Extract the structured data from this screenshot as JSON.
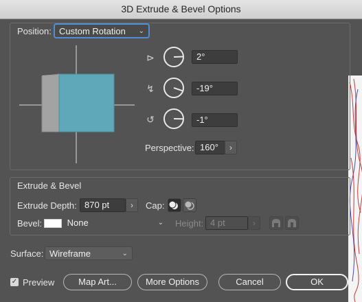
{
  "title": "3D Extrude & Bevel Options",
  "position": {
    "label": "Position:",
    "value": "Custom Rotation",
    "rotations": [
      {
        "axis": "x",
        "value": "2°",
        "angle": 2
      },
      {
        "axis": "y",
        "value": "-19°",
        "angle": -19
      },
      {
        "axis": "z",
        "value": "-1°",
        "angle": -1
      }
    ],
    "perspective_label": "Perspective:",
    "perspective_value": "160°"
  },
  "extrude_bevel": {
    "heading": "Extrude & Bevel",
    "depth_label": "Extrude Depth:",
    "depth_value": "870 pt",
    "cap_label": "Cap:",
    "bevel_label": "Bevel:",
    "bevel_value": "None",
    "height_label": "Height:",
    "height_value": "4 pt"
  },
  "surface": {
    "label": "Surface:",
    "value": "Wireframe"
  },
  "footer": {
    "preview_label": "Preview",
    "preview_checked": true,
    "map_art": "Map Art...",
    "more_options": "More Options",
    "cancel": "Cancel",
    "ok": "OK"
  },
  "colors": {
    "cube_front": "#5fa8b9",
    "cube_side": "#a3a3a3",
    "focus": "#4d8fd8"
  }
}
